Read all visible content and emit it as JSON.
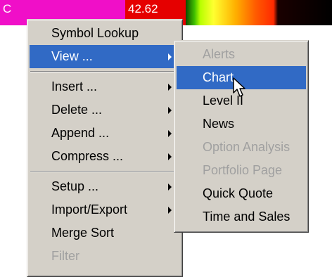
{
  "background": {
    "symbol_cell": "C",
    "price_cell": "42.62"
  },
  "context_menu": {
    "items": [
      {
        "label": "Symbol Lookup"
      },
      {
        "label": "View ..."
      },
      {
        "label": "Insert ..."
      },
      {
        "label": "Delete ..."
      },
      {
        "label": "Append ..."
      },
      {
        "label": "Compress ..."
      },
      {
        "label": "Setup ..."
      },
      {
        "label": "Import/Export"
      },
      {
        "label": "Merge Sort"
      },
      {
        "label": "Filter"
      }
    ]
  },
  "view_submenu": {
    "items": [
      {
        "label": "Alerts"
      },
      {
        "label": "Chart"
      },
      {
        "label": "Level II"
      },
      {
        "label": "News"
      },
      {
        "label": "Option Analysis"
      },
      {
        "label": "Portfolio Page"
      },
      {
        "label": "Quick Quote"
      },
      {
        "label": "Time and Sales"
      }
    ]
  },
  "cursor": {
    "icon": "arrow-pointer-icon"
  },
  "colors": {
    "menu_background": "#d4d0c8",
    "highlight": "#316ac5",
    "disabled_text": "#a0a0a0",
    "symbol_cell": "#f00fc8",
    "price_cell": "#e50000"
  }
}
